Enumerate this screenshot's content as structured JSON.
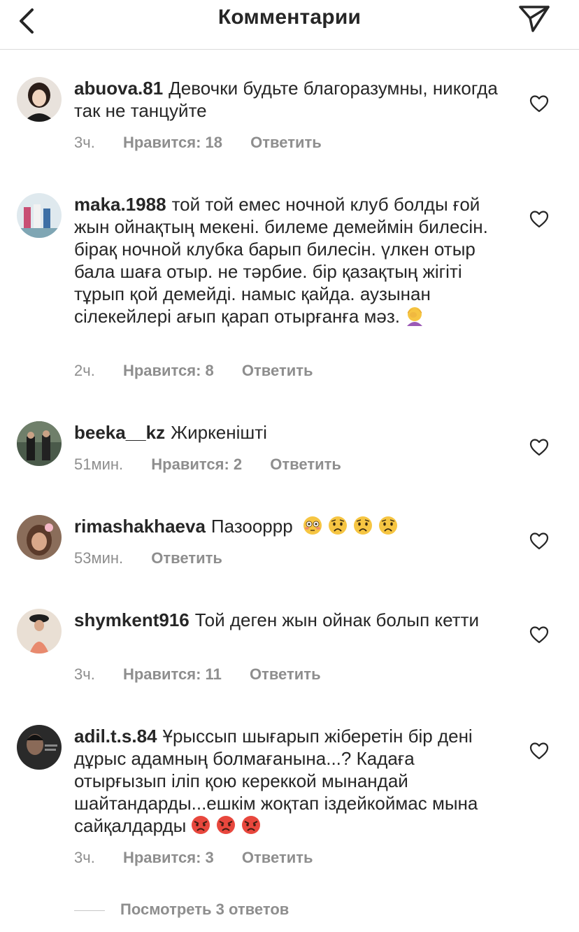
{
  "header": {
    "title": "Комментарии",
    "back_icon": "chevron-left-icon",
    "share_icon": "paper-plane-icon"
  },
  "comments": [
    {
      "username": "abuova.81",
      "text": "Девочки будьте благоразумны, никогда так не танцуйте",
      "time": "3ч.",
      "likes": "Нравится: 18",
      "reply": "Ответить"
    },
    {
      "username": "maka.1988",
      "text": "той той емес ночной клуб болды ғой жын ойнақтың мекені. билеме демеймін билесін. бірақ ночной клубка барып билесін. үлкен отыр бала шаға отыр. не тәрбие. бір қазақтың жігіті тұрып қой демейді. намыс қайда. аузынан сілекейлері ағып қарап отырғанға мәз.",
      "emoji": "woman-facepalming",
      "time": "2ч.",
      "likes": "Нравится: 8",
      "reply": "Ответить"
    },
    {
      "username": "beeka__kz",
      "text": "Жиркеніш­ті",
      "time": "51мин.",
      "likes": "Нравится: 2",
      "reply": "Ответить"
    },
    {
      "username": "rimashakhaeva",
      "text": "Пазоорpp",
      "emoji": "flushed-and-worried-faces",
      "time": "53мин.",
      "reply": "Ответить"
    },
    {
      "username": "shymkent916",
      "text": "Той деген  жын ойнак болып кетти",
      "time": "3ч.",
      "likes": "Нравится: 11",
      "reply": "Ответить"
    },
    {
      "username": "adil.t.s.84",
      "text": "Ұрыссып шығарып жіберетін бір дені дұрыс адамның болмағанына...? Кадаға отырғызып іліп қою кереккой мынандай шайтандарды...ешкім жоқтап іздейкоймас мына сайқалдарды",
      "emoji": "angry-faces",
      "time": "3ч.",
      "likes": "Нравится: 3",
      "reply": "Ответить"
    }
  ],
  "view_replies": "Посмотреть 3 ответов",
  "colors": {
    "text": "#262626",
    "secondary": "#8e8e8e",
    "divider": "#dbdbdb"
  }
}
